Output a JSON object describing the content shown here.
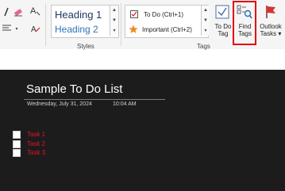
{
  "ribbon": {
    "groups": {
      "styles": "Styles",
      "tags": "Tags"
    },
    "styles": {
      "heading1": "Heading 1",
      "heading2": "Heading 2"
    },
    "tags": [
      {
        "label": "To Do (Ctrl+1)",
        "icon": "checkbox-checked-icon"
      },
      {
        "label": "Important (Ctrl+2)",
        "icon": "star-icon"
      }
    ],
    "buttons": {
      "todo_tag": "To Do\nTag",
      "find_tags": "Find\nTags",
      "outlook_tasks": "Outlook\nTasks ▾"
    }
  },
  "page": {
    "title": "Sample To Do List",
    "date": "Wednesday, July 31, 2024",
    "time": "10:04 AM",
    "tasks": [
      "Task 1",
      "Task 2",
      "Task 3"
    ]
  },
  "colors": {
    "accent_red": "#e81123",
    "highlight": "#e3000f",
    "heading1": "#1f3864",
    "heading2": "#2e75b6",
    "page_bg": "#202020"
  }
}
